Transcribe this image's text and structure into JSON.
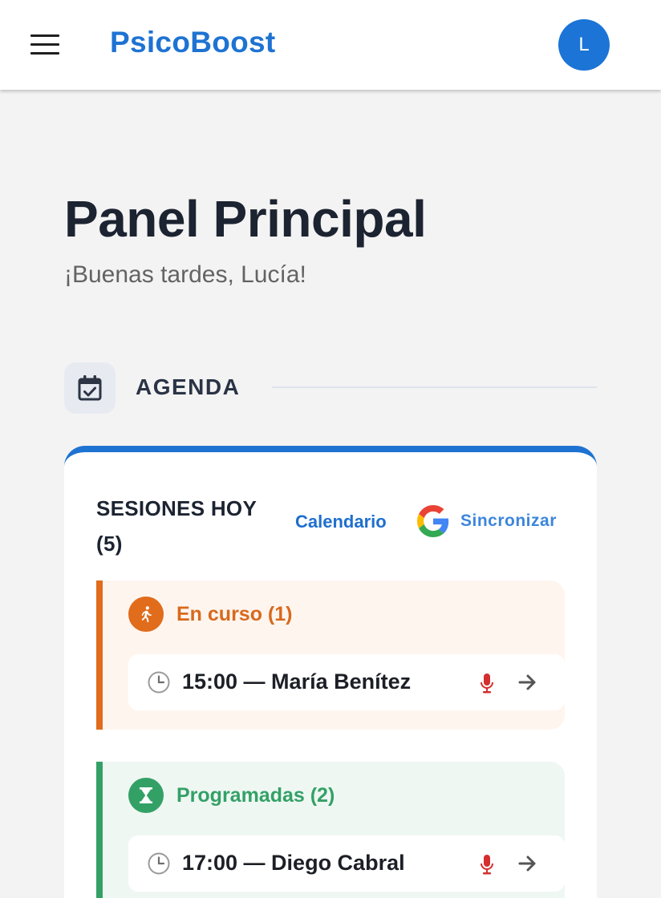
{
  "app": {
    "brand": "PsicoBoost",
    "avatar_initial": "L"
  },
  "page": {
    "title": "Panel Principal",
    "greeting": "¡Buenas tardes, Lucía!"
  },
  "section": {
    "title": "AGENDA",
    "icon": "calendar-check-icon"
  },
  "sessions_card": {
    "title": "SESIONES HOY (5)",
    "calendar_link": "Calendario",
    "sync_label": "Sincronizar",
    "accent_color": "#1e73d2",
    "groups": [
      {
        "label": "En curso (1)",
        "icon": "running-person-icon",
        "color": "#e06c1c",
        "sessions": [
          {
            "text": "15:00 — María Benítez"
          }
        ]
      },
      {
        "label": "Programadas (2)",
        "icon": "hourglass-icon",
        "color": "#33a166",
        "sessions": [
          {
            "text": "17:00 — Diego Cabral"
          }
        ]
      }
    ]
  }
}
